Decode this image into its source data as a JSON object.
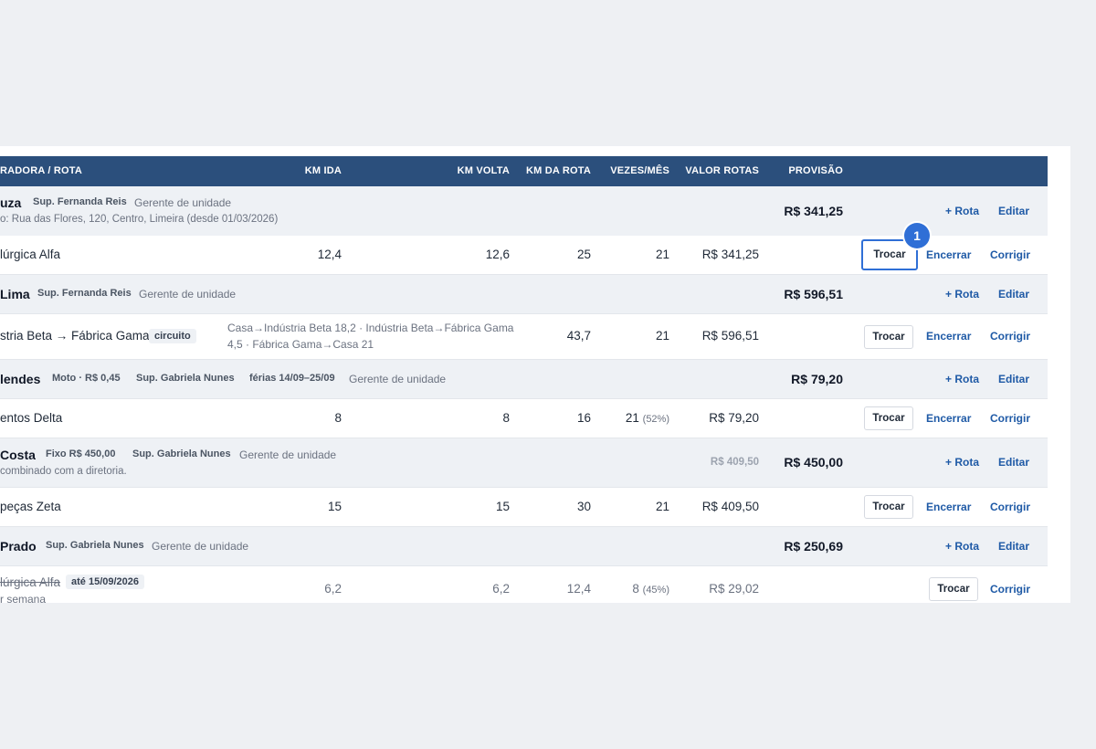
{
  "table": {
    "headers": {
      "operator_route": "RADORA / ROTA",
      "km_ida": "KM IDA",
      "km_volta": "KM VOLTA",
      "km_rota": "KM DA ROTA",
      "vezes_mes": "VEZES/MÊS",
      "valor_rotas": "VALOR ROTAS",
      "provisao": "PROVISÃO"
    },
    "actions": {
      "add_route": "+ Rota",
      "edit": "Editar",
      "swap": "Trocar",
      "close": "Encerrar",
      "fix": "Corrigir"
    },
    "groups": [
      {
        "name": "uza",
        "supervisor": "Sup. Fernanda Reis",
        "manager": "Gerente de unidade",
        "address": "o: Rua das Flores, 120, Centro, Limeira (desde 01/03/2026)",
        "provision": "R$ 341,25",
        "route": {
          "name": "lúrgica Alfa",
          "km_ida": "12,4",
          "km_volta": "12,6",
          "km_rota": "25",
          "vezes": "21",
          "valor": "R$ 341,25"
        }
      },
      {
        "name": "Lima",
        "supervisor": "Sup. Fernanda Reis",
        "manager": "Gerente de unidade",
        "provision": "R$ 596,51",
        "route": {
          "name": "stria Beta → Fábrica Gama",
          "tag": "circuito",
          "detail_line1": "Casa→Indústria Beta 18,2 · Indústria Beta→Fábrica Gama",
          "detail_line2": "4,5 · Fábrica Gama→Casa 21",
          "km_rota": "43,7",
          "vezes": "21",
          "valor": "R$ 596,51"
        }
      },
      {
        "name": "lendes",
        "vehicle": "Moto · R$ 0,45",
        "supervisor": "Sup. Gabriela Nunes",
        "vacation": "férias 14/09–25/09",
        "manager": "Gerente de unidade",
        "provision": "R$ 79,20",
        "route": {
          "name": "entos Delta",
          "km_ida": "8",
          "km_volta": "8",
          "km_rota": "16",
          "vezes": "21",
          "vezes_pct": "(52%)",
          "valor": "R$ 79,20"
        }
      },
      {
        "name": "Costa",
        "fixed": "Fixo R$ 450,00",
        "supervisor": "Sup. Gabriela Nunes",
        "manager": "Gerente de unidade",
        "note": "combinado com a diretoria.",
        "route_total": "R$ 409,50",
        "provision": "R$ 450,00",
        "route": {
          "name": "peças Zeta",
          "km_ida": "15",
          "km_volta": "15",
          "km_rota": "30",
          "vezes": "21",
          "valor": "R$ 409,50"
        }
      },
      {
        "name": "Prado",
        "supervisor": "Sup. Gabriela Nunes",
        "manager": "Gerente de unidade",
        "provision": "R$ 250,69",
        "route": {
          "name": "lúrgica Alfa",
          "until": "até 15/09/2026",
          "subtext": "r semana",
          "km_ida": "6,2",
          "km_volta": "6,2",
          "km_rota": "12,4",
          "vezes": "8",
          "vezes_pct": "(45%)",
          "valor": "R$ 29,02"
        }
      }
    ]
  },
  "annotation": {
    "badge": "1"
  }
}
